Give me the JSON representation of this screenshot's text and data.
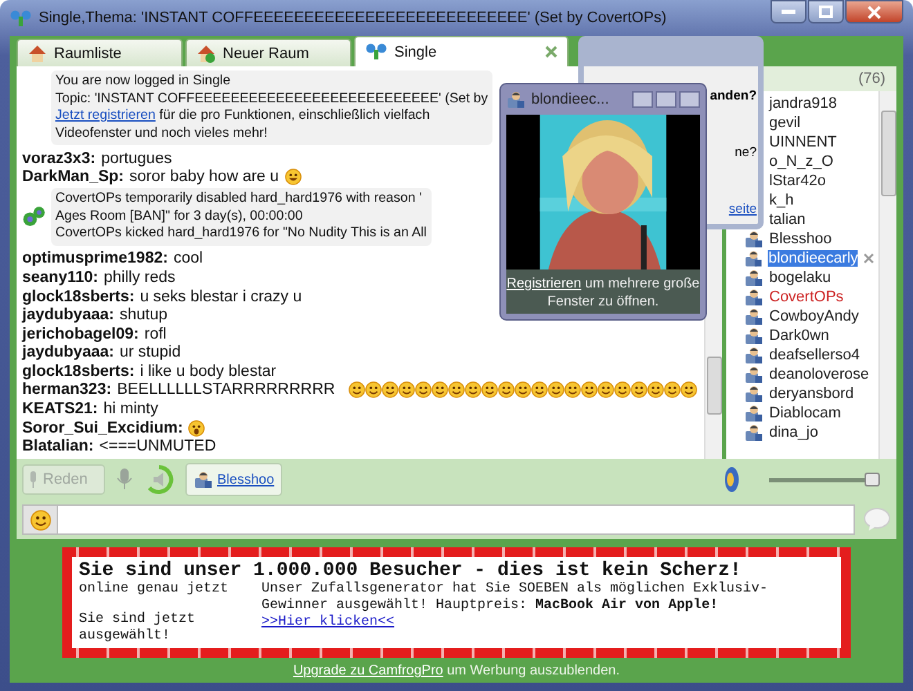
{
  "window": {
    "title": "Single,Thema: 'INSTANT COFFEEEEEEEEEEEEEEEEEEEEEEEEEEE' (Set by CovertOPs)"
  },
  "tabs": [
    {
      "label": "Raumliste",
      "kind": "rooms",
      "selected": false,
      "closable": false
    },
    {
      "label": "Neuer Raum",
      "kind": "new",
      "selected": false,
      "closable": false
    },
    {
      "label": "Single",
      "kind": "room",
      "selected": true,
      "closable": true
    }
  ],
  "chat": [
    {
      "kind": "system",
      "lines": [
        {
          "text": "You are now logged in Single"
        },
        {
          "text": "Topic: 'INSTANT COFFEEEEEEEEEEEEEEEEEEEEEEEEEEE' (Set by"
        },
        {
          "link": "Jetzt registrieren",
          "text": " für die pro Funktionen, einschließlich vielfach"
        },
        {
          "text": "Videofenster und noch vieles mehr!"
        }
      ]
    },
    {
      "kind": "user",
      "name": "voraz3x3:",
      "text": "portugues"
    },
    {
      "kind": "user",
      "name": "DarkMan_Sp:",
      "text": "soror baby how are u",
      "emoticons": [
        {
          "kind": "grin"
        }
      ]
    },
    {
      "kind": "moderator",
      "lines": [
        {
          "text": "CovertOPs temporarily disabled hard_hard1976 with reason '"
        },
        {
          "text": "Ages Room [BAN]\" for 3 day(s), 00:00:00"
        },
        {
          "text": "CovertOPs kicked hard_hard1976 for \"No Nudity This is an All"
        }
      ]
    },
    {
      "kind": "user",
      "name": "optimusprime1982:",
      "text": "cool"
    },
    {
      "kind": "user",
      "name": "seany110:",
      "text": "philly reds"
    },
    {
      "kind": "user",
      "name": "glock18sberts:",
      "text": "u seks blestar i crazy u"
    },
    {
      "kind": "user",
      "name": "jaydubyaaa:",
      "text": "shutup"
    },
    {
      "kind": "user",
      "name": "jerichobagel09:",
      "text": "rofl"
    },
    {
      "kind": "user",
      "name": "jaydubyaaa:",
      "text": "ur stupid"
    },
    {
      "kind": "user",
      "name": "glock18sberts:",
      "text": "i like u body blestar"
    },
    {
      "kind": "user",
      "name": "herman323:",
      "text": "BEELLLLLLSTARRRRRRRRR",
      "emoticons": [
        {
          "kind": "smile"
        },
        {
          "kind": "smile"
        },
        {
          "kind": "smile"
        },
        {
          "kind": "smile"
        },
        {
          "kind": "smile"
        },
        {
          "kind": "smile"
        },
        {
          "kind": "smile"
        },
        {
          "kind": "smile"
        },
        {
          "kind": "smile"
        },
        {
          "kind": "smile"
        },
        {
          "kind": "smile"
        },
        {
          "kind": "smile"
        },
        {
          "kind": "smile"
        },
        {
          "kind": "smile"
        },
        {
          "kind": "smile"
        },
        {
          "kind": "smile"
        },
        {
          "kind": "smile"
        },
        {
          "kind": "smile"
        },
        {
          "kind": "smile"
        },
        {
          "kind": "smile"
        },
        {
          "kind": "smile"
        }
      ]
    },
    {
      "kind": "user",
      "name": "KEATS21:",
      "text": "hi minty"
    },
    {
      "kind": "user",
      "name": "Soror_Sui_Excidium:",
      "emoticons": [
        {
          "kind": "shock"
        }
      ]
    },
    {
      "kind": "user",
      "name": "Blatalian:",
      "text": "<===UNMUTED"
    }
  ],
  "user_list": {
    "header": "(76)",
    "users": [
      {
        "name": "jandra918",
        "selected": false
      },
      {
        "name": "gevil",
        "selected": false
      },
      {
        "name": "UINNENT",
        "selected": false
      },
      {
        "name": "o_N_z_O",
        "selected": false
      },
      {
        "name": "lStar42o",
        "selected": false
      },
      {
        "name": "k_h",
        "selected": false
      },
      {
        "name": "talian",
        "selected": false
      },
      {
        "name": "Blesshoo",
        "selected": false
      },
      {
        "name": "blondieecarly",
        "selected": true
      },
      {
        "name": "bogelaku",
        "selected": false
      },
      {
        "name": "CovertOPs",
        "selected": false,
        "color": "#cc2222"
      },
      {
        "name": "CowboyAndy",
        "selected": false
      },
      {
        "name": "Dark0wn",
        "selected": false
      },
      {
        "name": "deafsellerso4",
        "selected": false
      },
      {
        "name": "deanoloverose",
        "selected": false
      },
      {
        "name": "deryansbord",
        "selected": false
      },
      {
        "name": "Diablocam",
        "selected": false
      },
      {
        "name": "dina_jo",
        "selected": false
      }
    ]
  },
  "dialog": {
    "lines": [
      {
        "text": "anden?",
        "kind": "heading"
      },
      {
        "text": "ne?",
        "kind": "plain"
      },
      {
        "text": "seite",
        "kind": "link"
      }
    ]
  },
  "video_window": {
    "title": "blondieec...",
    "caption_link": "Registrieren",
    "caption": " um mehrere große Fenster zu öffnen."
  },
  "toolbar": {
    "talk": {
      "label": "Reden",
      "disabled": true
    },
    "speaker_user": "Blesshoo",
    "volume": {
      "level": 0.93
    }
  },
  "ad": {
    "title": "Sie sind unser 1.000.000 Besucher - dies ist kein Scherz!",
    "left_lines": [
      "online genau jetzt",
      "Sie sind jetzt ausgewählt!"
    ],
    "body": "Unser Zufallsgenerator hat Sie SOEBEN als möglichen Exklusiv-Gewinner ausgewählt! Hauptpreis: **MacBook Air von Apple!**",
    "link": ">>Hier klicken<<"
  },
  "footer": {
    "link": "Upgrade zu CamfrogPro",
    "text": " um Werbung auszublenden."
  }
}
